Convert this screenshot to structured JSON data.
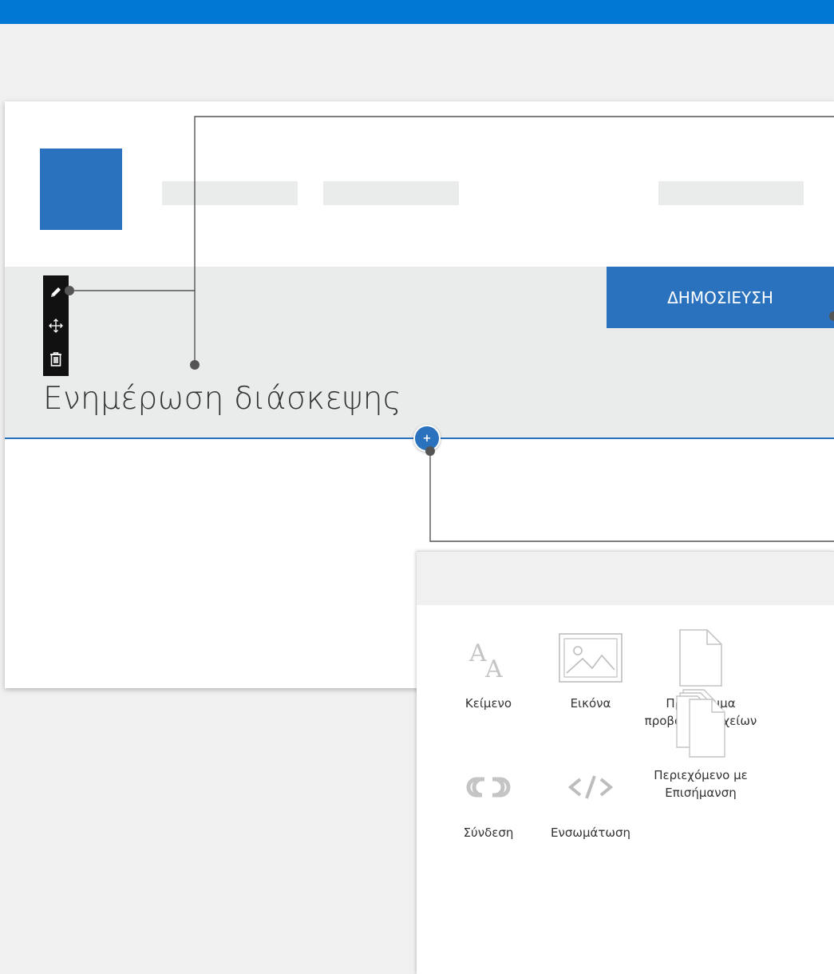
{
  "page": {
    "title": "Ενημέρωση διάσκεψης",
    "publish_label": "ΔΗΜΟΣΙΕΥΣΗ",
    "add_label": "+"
  },
  "toolbar": {
    "icons": [
      "pencil-icon",
      "move-icon",
      "trash-icon"
    ]
  },
  "toolbox": {
    "tools": [
      {
        "label": "Κείμενο",
        "icon": "text-icon"
      },
      {
        "label": "Εικόνα",
        "icon": "image-icon"
      },
      {
        "label": "Πρόγραμμα προβολής αρχείων",
        "icon": "document-icon"
      },
      {
        "label": "Σύνδεση",
        "icon": "link-icon"
      },
      {
        "label": "Ενσωμάτωση",
        "icon": "embed-icon"
      },
      {
        "label": "Περιεχόμενο με Επισήμανση",
        "icon": "documents-stack-icon"
      }
    ]
  },
  "colors": {
    "accent": "#2a72be",
    "topbar": "#0078d4",
    "band": "#eaebeb",
    "toolbar": "#111111",
    "callout": "#555555"
  }
}
